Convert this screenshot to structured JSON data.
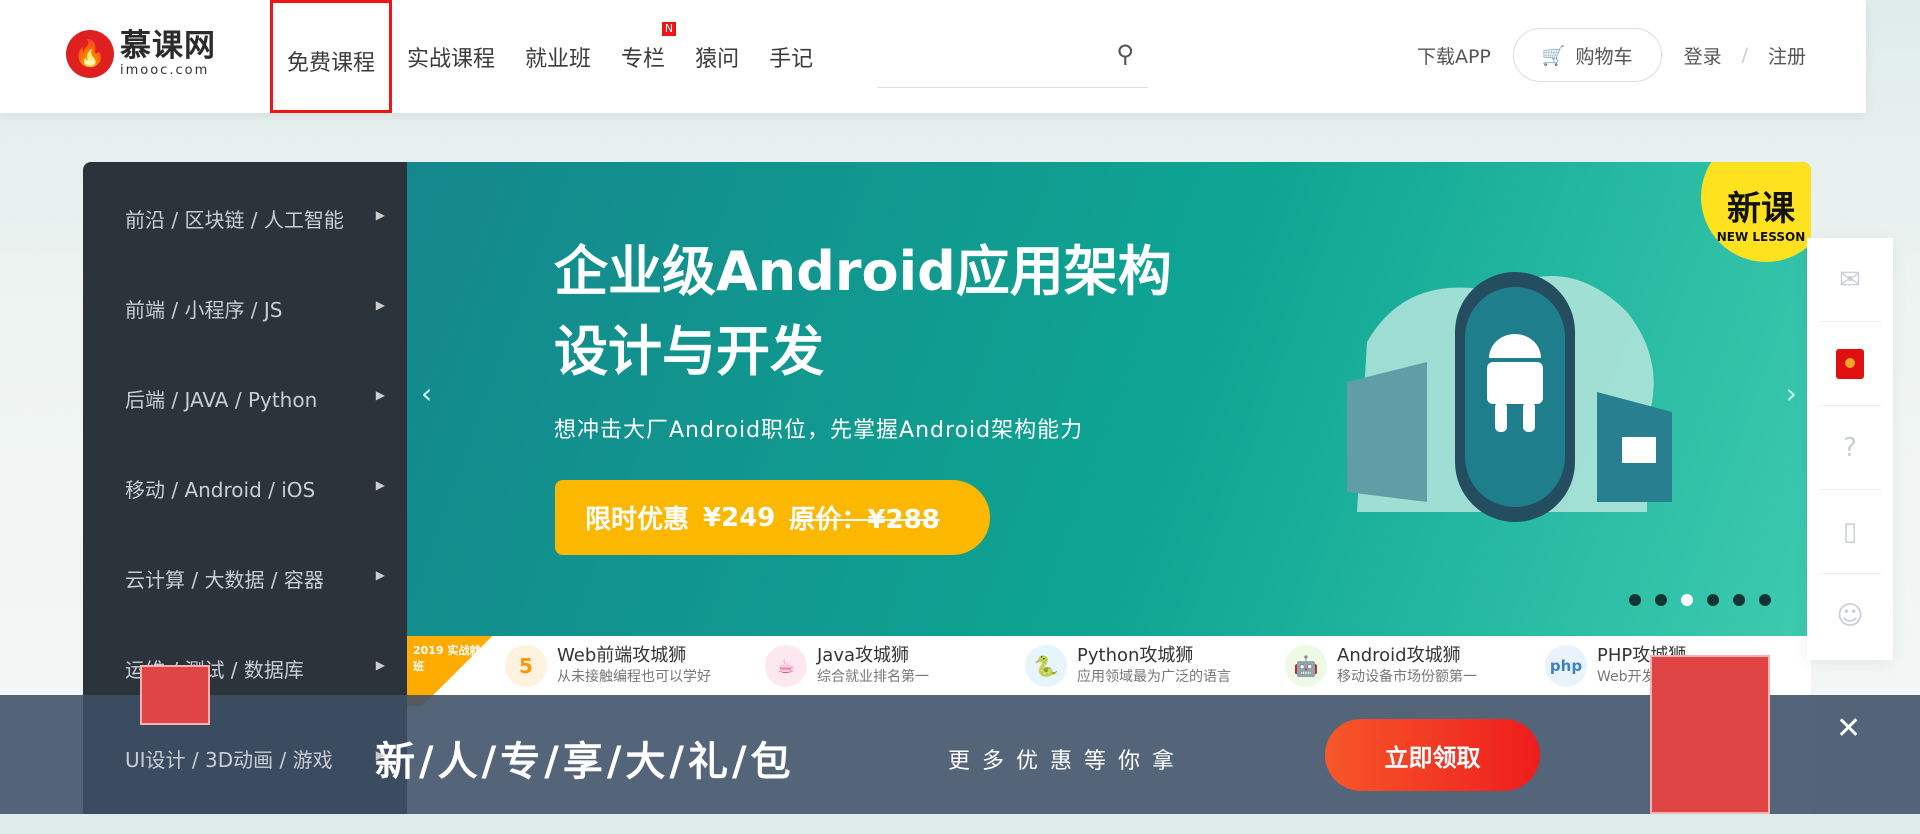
{
  "header": {
    "logo_cn": "慕课网",
    "logo_en": "imooc.com",
    "nav": [
      {
        "label": "免费课程",
        "active": true
      },
      {
        "label": "实战课程"
      },
      {
        "label": "就业班"
      },
      {
        "label": "专栏",
        "badge": "N"
      },
      {
        "label": "猿问"
      },
      {
        "label": "手记"
      }
    ],
    "download": "下载APP",
    "cart": "购物车",
    "login": "登录",
    "divider": "/",
    "register": "注册"
  },
  "sidebar": {
    "items": [
      "前沿 / 区块链 / 人工智能",
      "前端 / 小程序 / JS",
      "后端 / JAVA / Python",
      "移动 / Android / iOS",
      "云计算 / 大数据 / 容器",
      "运维 / 测试 / 数据库",
      "UI设计 / 3D动画 / 游戏"
    ]
  },
  "banner": {
    "title_line1": "企业级Android应用架构",
    "title_line2": "设计与开发",
    "subtitle": "想冲击大厂Android职位，先掌握Android架构能力",
    "price_label": "限时优惠",
    "price": "¥249",
    "original_label": "原价：",
    "original_price": "¥288",
    "badge_cn": "新课",
    "badge_en": "NEW LESSON",
    "slide_count": 6,
    "active_slide": 2
  },
  "cards": {
    "ribbon": "2019 实战就业班",
    "items": [
      {
        "icon": "5",
        "title": "Web前端攻城狮",
        "desc": "从未接触编程也可以学好",
        "color": "#ff9800"
      },
      {
        "icon": "☕",
        "title": "Java攻城狮",
        "desc": "综合就业排名第一",
        "color": "#ef4f8c"
      },
      {
        "icon": "🐍",
        "title": "Python攻城狮",
        "desc": "应用领域最为广泛的语言",
        "color": "#2f6fa6"
      },
      {
        "icon": "🤖",
        "title": "Android攻城狮",
        "desc": "移动设备市场份额第一",
        "color": "#9bc53d"
      },
      {
        "icon": "php",
        "title": "PHP攻城狮",
        "desc": "Web开发首选语言",
        "color": "#3b82c4"
      }
    ]
  },
  "promo": {
    "title": "新/人/专/享/大/礼/包",
    "subtitle": "更多优惠等你拿",
    "button": "立即领取"
  }
}
